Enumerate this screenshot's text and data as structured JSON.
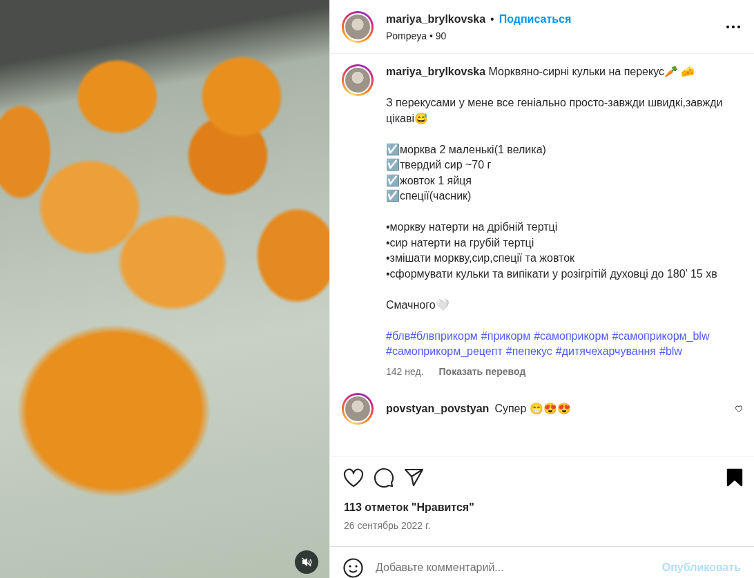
{
  "photo": {
    "muted": true
  },
  "header": {
    "username": "mariya_brylkovska",
    "separator": "•",
    "follow": "Подписаться",
    "subtitle": "Pompeya • 90",
    "story_ring": true
  },
  "caption": {
    "username": "mariya_brylkovska",
    "title": "Морквяно-сирні кульки на перекус🥕 🧀",
    "story_ring": true,
    "paragraphs": [
      [
        "З перекусами у мене все геніально просто-завжди швидкі,завжди цікаві😅"
      ],
      [
        "☑️морква 2 маленькі(1 велика)",
        "☑️твердий сир ~70 г",
        "☑️жовток 1 яйця",
        "☑️спеції(часник)"
      ],
      [
        "•моркву натерти на дрібній тертці",
        "•сир натерти на грубій тертці",
        "•змішати моркву,сир,спеції та жовток",
        "•сформувати кульки та випікати у розігрітій духовці до 180’ 15 хв"
      ],
      [
        "Смачного🤍"
      ]
    ],
    "hashtags": [
      "#блв#блвприкорм",
      "#прикорм",
      "#самоприкорм",
      "#самоприкорм_blw",
      "#самоприкорм_рецепт",
      "#пепекус",
      "#дитячехарчування",
      "#blw"
    ],
    "age": "142 нед.",
    "translate": "Показать перевод"
  },
  "comments": [
    {
      "username": "povstyan_povstyan",
      "text": "Супер 😁😍😍",
      "story_ring": true,
      "liked": false
    }
  ],
  "actions": {
    "liked": false,
    "saved": true
  },
  "likes": "113 отметок \"Нравится\"",
  "date": "26 сентябрь 2022 г.",
  "comment_box": {
    "placeholder": "Добавьте комментарий...",
    "post": "Опубликовать",
    "disabled": true
  }
}
